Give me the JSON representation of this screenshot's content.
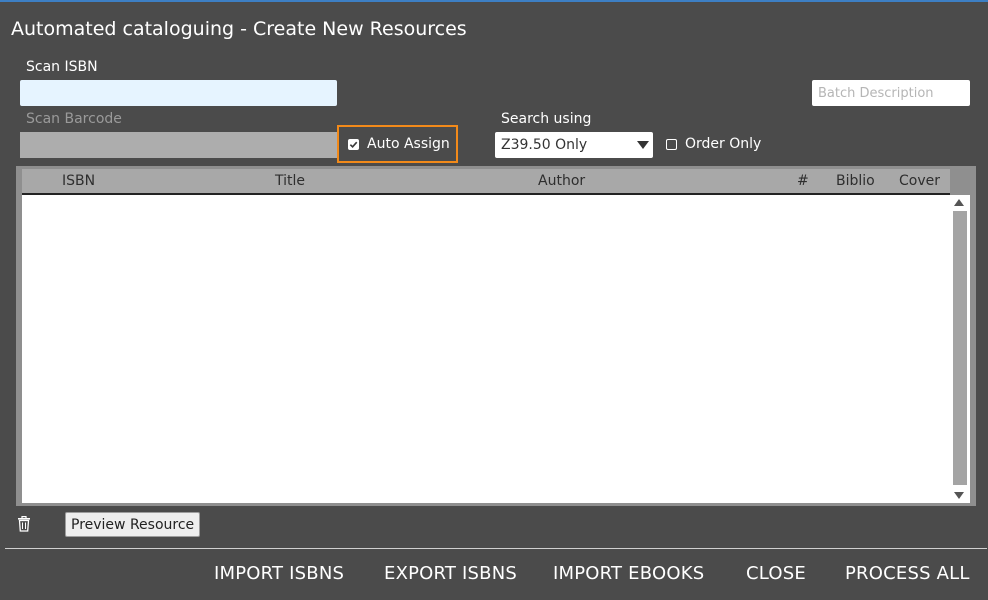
{
  "window": {
    "title": "Automated cataloguing - Create New Resources"
  },
  "form": {
    "scan_isbn_label": "Scan ISBN",
    "scan_isbn_value": "",
    "scan_barcode_label": "Scan Barcode",
    "scan_barcode_value": "",
    "batch_description_placeholder": "Batch Description",
    "auto_assign_label": "Auto Assign",
    "auto_assign_checked": true,
    "search_using_label": "Search using",
    "search_using_value": "Z39.50 Only",
    "order_only_label": "Order Only",
    "order_only_checked": false
  },
  "table": {
    "columns": [
      "ISBN",
      "Title",
      "Author",
      "#",
      "Biblio",
      "Cover"
    ],
    "rows": []
  },
  "toolbar": {
    "preview_label": "Preview Resource"
  },
  "actions": {
    "import_isbns": "IMPORT ISBNS",
    "export_isbns": "EXPORT ISBNS",
    "import_ebooks": "IMPORT EBOOKS",
    "close": "CLOSE",
    "process_all": "PROCESS ALL"
  },
  "colors": {
    "background": "#4b4b4b",
    "highlight": "#f28a1a",
    "isbn_field": "#e6f4ff"
  },
  "icons": {
    "delete": "trash-icon",
    "auto_assign_check": "check-icon"
  }
}
